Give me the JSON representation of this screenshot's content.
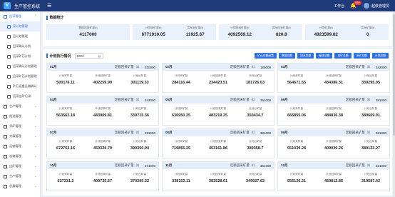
{
  "app": {
    "title": "生产管控系统",
    "logo": "V",
    "workspace": "工作台",
    "bell_badge": "99+",
    "user": "超级管理员"
  },
  "sidebar": {
    "group": "回采管理",
    "subitems": [
      "采计划管理",
      "回计划管理",
      "回采确认计划",
      "回采矿石计划",
      "回采确认计划管理",
      "回采矿石计划管理",
      "矿石设备运输确认",
      "回采出矿记录"
    ],
    "items": [
      "生产管理",
      "掘进管理",
      "采矿管理",
      "充填管理",
      "运输管理",
      "机电管理",
      "出矿管理",
      "生产管理",
      "质量管理"
    ]
  },
  "stats": {
    "title": "数据统计",
    "boxes": [
      [
        {
          "label": "数据回采矿量(t)",
          "value": "4117000"
        }
      ],
      [
        {
          "label": "计划采矿量(t)",
          "value": "6771910.05"
        },
        {
          "label": "实际采矿量(t)",
          "value": "11925.67"
        }
      ],
      [
        {
          "label": "计划回采矿量(t)",
          "value": "4092569.12"
        },
        {
          "label": "实际回采矿量(t)",
          "value": "820.8"
        }
      ],
      [
        {
          "label": "计划矿量(t)",
          "value": "4923599.82"
        },
        {
          "label": "实际矿量(t)",
          "value": "0"
        }
      ]
    ]
  },
  "plan": {
    "title": "计划执行情况",
    "year": "2024",
    "buttons": [
      "矿石总额配置",
      "数据总额",
      "回采总额",
      "掘进总额",
      "出矿总额",
      "采矿总额",
      "计划总额"
    ],
    "plan_label": "定额回采矿量（t）",
    "col_labels": [
      "计划采矿量",
      "计划回采矿量",
      "计划出矿量"
    ],
    "months": [
      {
        "month": "01月",
        "plan": "310000",
        "vals": [
          "500176.11",
          "402259.99",
          "301119.33"
        ]
      },
      {
        "month": "02月",
        "plan": "185000",
        "vals": [
          "284116.44",
          "234423.51",
          "181726.63"
        ]
      },
      {
        "month": "03月",
        "plan": "342000",
        "vals": [
          "564671.55",
          "434386.31",
          "339295.95"
        ]
      },
      {
        "month": "04月",
        "plan": "342000",
        "vals": [
          "563562.18",
          "443909.81",
          "339715.36"
        ]
      },
      {
        "month": "05月",
        "plan": "351000",
        "vals": [
          "636950.25",
          "483219.25",
          "350434.7"
        ]
      },
      {
        "month": "06月",
        "plan": "381000",
        "vals": [
          "666855.06",
          "484836.38",
          "380669.91"
        ]
      },
      {
        "month": "07月",
        "plan": "391000",
        "vals": [
          "672753.16",
          "450326.79",
          "390350.04"
        ]
      },
      {
        "month": "08月",
        "plan": "381000",
        "vals": [
          "719855.25",
          "453161.86",
          "389358.7"
        ]
      },
      {
        "month": "09月",
        "plan": "381000",
        "vals": [
          "551039.28",
          "409039.26",
          "380123.27"
        ]
      },
      {
        "month": "10月",
        "plan": "371000",
        "vals": [
          "527331.2",
          "409735.57",
          "370290.32"
        ]
      },
      {
        "month": "11月",
        "plan": "351000",
        "vals": [
          "338153.11",
          "382528.61",
          "349927.62"
        ]
      },
      {
        "month": "12月",
        "plan": "321000",
        "vals": [
          "556126.21",
          "459812.85",
          "319587.42"
        ]
      }
    ]
  }
}
